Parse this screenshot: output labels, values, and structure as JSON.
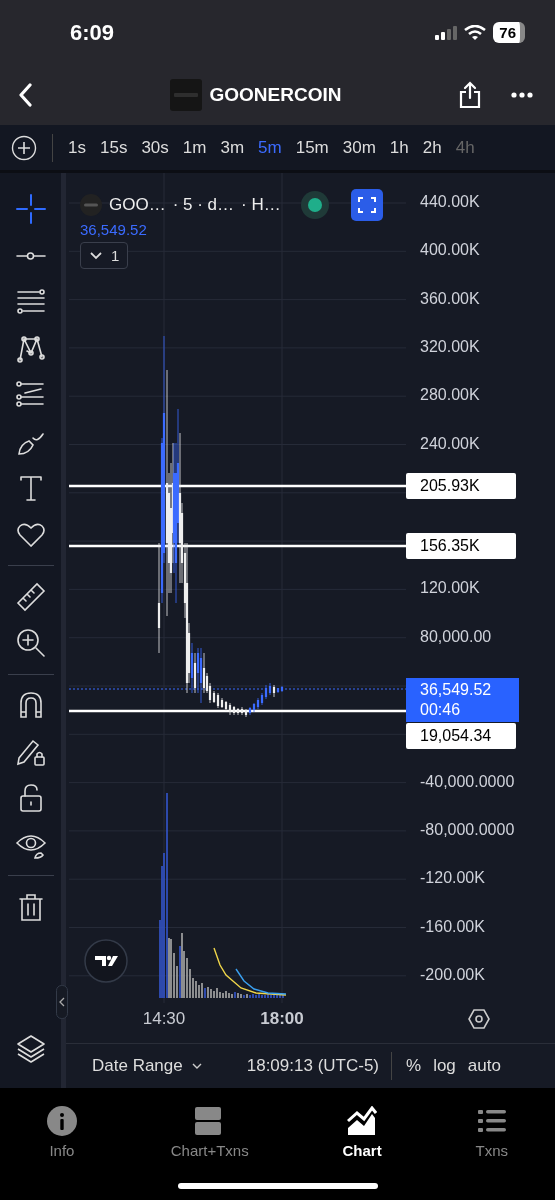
{
  "status_bar": {
    "time": "6:09",
    "battery": "76"
  },
  "header": {
    "title": "GOONERCOIN"
  },
  "intervals": [
    {
      "label": "1s",
      "selected": false,
      "faded": false
    },
    {
      "label": "15s",
      "selected": false,
      "faded": false
    },
    {
      "label": "30s",
      "selected": false,
      "faded": false
    },
    {
      "label": "1m",
      "selected": false,
      "faded": false
    },
    {
      "label": "3m",
      "selected": false,
      "faded": false
    },
    {
      "label": "5m",
      "selected": true,
      "faded": false
    },
    {
      "label": "15m",
      "selected": false,
      "faded": false
    },
    {
      "label": "30m",
      "selected": false,
      "faded": false
    },
    {
      "label": "1h",
      "selected": false,
      "faded": false
    },
    {
      "label": "2h",
      "selected": false,
      "faded": false
    },
    {
      "label": "4h",
      "selected": false,
      "faded": true
    }
  ],
  "tools": [
    {
      "kind": "crosshair",
      "selected": true
    },
    {
      "kind": "trend-line",
      "selected": false
    },
    {
      "kind": "fib",
      "selected": false
    },
    {
      "kind": "pattern",
      "selected": false
    },
    {
      "kind": "projection",
      "selected": false
    },
    {
      "kind": "brush",
      "selected": false
    },
    {
      "kind": "text",
      "selected": false
    },
    {
      "kind": "heart",
      "selected": false
    },
    {
      "kind": "divider"
    },
    {
      "kind": "ruler",
      "selected": false
    },
    {
      "kind": "zoom",
      "selected": false
    },
    {
      "kind": "divider"
    },
    {
      "kind": "magnet",
      "selected": false
    },
    {
      "kind": "pencil-lock",
      "selected": false
    },
    {
      "kind": "unlock",
      "selected": false
    },
    {
      "kind": "eye",
      "selected": false
    },
    {
      "kind": "divider"
    },
    {
      "kind": "trash",
      "selected": false
    }
  ],
  "legend": {
    "symbol": "GOO…",
    "interval": "· 5 · d…",
    "source": "· H…",
    "live": true,
    "price": "36,549.52",
    "indicators_count": "1"
  },
  "price_axis": {
    "ticks": [
      "440.00K",
      "400.00K",
      "360.00K",
      "320.00K",
      "280.00K",
      "240.00K",
      "120.00K",
      "80,000.00",
      "-40,000.0000",
      "-80,000.0000",
      "-120.00K",
      "-160.00K",
      "-200.00K"
    ]
  },
  "lines": [
    {
      "label": "205.93K"
    },
    {
      "label": "156.35K"
    },
    {
      "label": "19,054.34"
    }
  ],
  "current": {
    "price": "36,549.52",
    "countdown": "00:46"
  },
  "time_axis": [
    {
      "label": "14:30",
      "bold": false
    },
    {
      "label": "18:00",
      "bold": true
    }
  ],
  "footer": {
    "date_range": "Date Range",
    "time": "18:09:13 (UTC-5)",
    "percent": "%",
    "log": "log",
    "auto": "auto"
  },
  "tabs": [
    {
      "label": "Info",
      "kind": "info",
      "selected": false
    },
    {
      "label": "Chart+Txns",
      "kind": "split",
      "selected": false
    },
    {
      "label": "Chart",
      "kind": "chart",
      "selected": true
    },
    {
      "label": "Txns",
      "kind": "list",
      "selected": false
    }
  ]
}
